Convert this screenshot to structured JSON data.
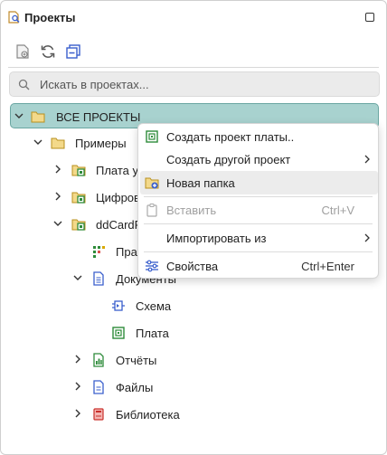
{
  "panel": {
    "title": "Проекты",
    "icon": "projects-search-icon"
  },
  "toolbar": {
    "buttons": [
      {
        "name": "new-project-icon"
      },
      {
        "name": "refresh-icon"
      },
      {
        "name": "collapse-all-icon"
      }
    ]
  },
  "search": {
    "placeholder": "Искать в проектах...",
    "value": ""
  },
  "tree": {
    "root": {
      "label": "ВСЕ ПРОЕКТЫ",
      "expanded": true
    },
    "items": [
      {
        "label": "Примеры",
        "icon": "folder-icon",
        "expanded": true
      },
      {
        "label": "Плата у",
        "icon": "board-project-icon",
        "expanded": false
      },
      {
        "label": "Цифрово",
        "icon": "board-project-icon",
        "expanded": false
      },
      {
        "label": "ddCardF",
        "icon": "board-project-icon",
        "expanded": true
      },
      {
        "label": "Пра",
        "icon": "rules-icon"
      },
      {
        "label": "Документы",
        "icon": "documents-icon",
        "expanded": true
      },
      {
        "label": "Схема",
        "icon": "schematic-icon"
      },
      {
        "label": "Плата",
        "icon": "pcb-icon"
      },
      {
        "label": "Отчёты",
        "icon": "reports-icon",
        "expanded": false
      },
      {
        "label": "Файлы",
        "icon": "files-icon",
        "expanded": false
      },
      {
        "label": "Библиотека",
        "icon": "library-icon",
        "expanded": false
      }
    ]
  },
  "context_menu": {
    "items": [
      {
        "label": "Создать проект платы..",
        "icon": "board-project-icon",
        "shortcut": "",
        "submenu": false,
        "disabled": false
      },
      {
        "label": "Создать другой проект",
        "icon": "",
        "shortcut": "",
        "submenu": true,
        "disabled": false
      },
      {
        "label": "Новая папка",
        "icon": "new-folder-icon",
        "shortcut": "",
        "submenu": false,
        "disabled": false,
        "highlighted": true
      },
      {
        "label": "Вставить",
        "icon": "paste-icon",
        "shortcut": "Ctrl+V",
        "submenu": false,
        "disabled": true
      },
      {
        "label": "Импортировать из",
        "icon": "",
        "shortcut": "",
        "submenu": true,
        "disabled": false
      },
      {
        "label": "Свойства",
        "icon": "properties-icon",
        "shortcut": "Ctrl+Enter",
        "submenu": false,
        "disabled": false
      }
    ]
  },
  "colors": {
    "selection": "#a8d2cf",
    "selection_border": "#6aa6a2",
    "folder": "#e6c36a",
    "board_green": "#2e8b3a",
    "doc_blue": "#3a5fcd",
    "library_red": "#d9534f"
  }
}
